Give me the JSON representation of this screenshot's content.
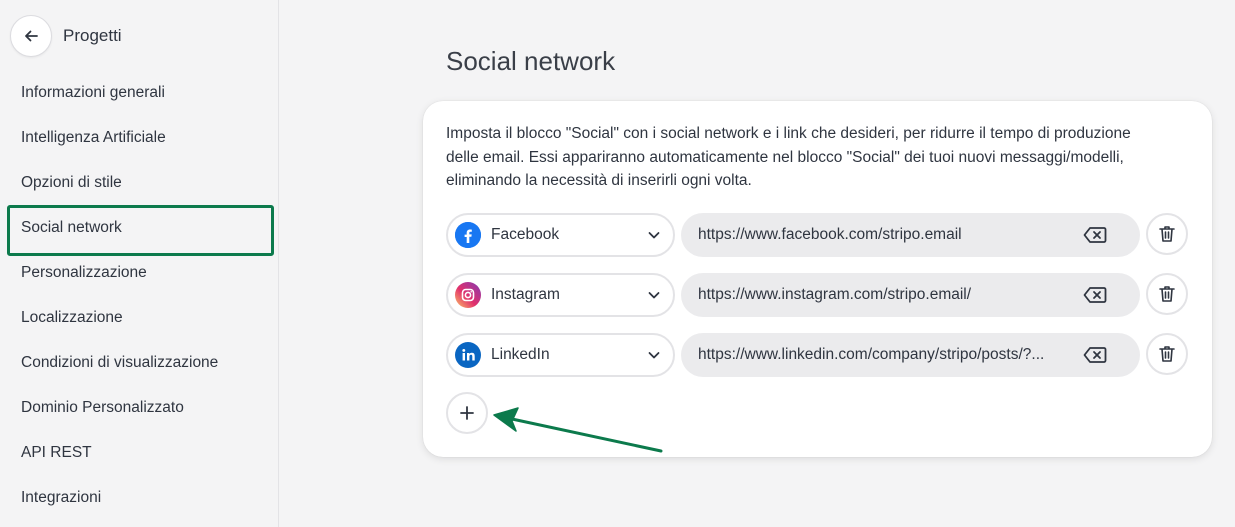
{
  "sidebar": {
    "back_title": "Progetti",
    "items": [
      {
        "label": "Informazioni generali",
        "active": false
      },
      {
        "label": "Intelligenza Artificiale",
        "active": false
      },
      {
        "label": "Opzioni di stile",
        "active": false
      },
      {
        "label": "Social network",
        "active": true
      },
      {
        "label": "Personalizzazione",
        "active": false
      },
      {
        "label": "Localizzazione",
        "active": false
      },
      {
        "label": "Condizioni di visualizzazione",
        "active": false
      },
      {
        "label": "Dominio Personalizzato",
        "active": false
      },
      {
        "label": "API REST",
        "active": false
      },
      {
        "label": "Integrazioni",
        "active": false
      }
    ]
  },
  "main": {
    "title": "Social network",
    "description": "Imposta il blocco \"Social\" con i social network e i link che desideri, per ridurre il tempo di produzione delle email. Essi appariranno automaticamente nel blocco \"Social\" dei tuoi nuovi messaggi/modelli, eliminando la necessità di inserirli ogni volta.",
    "social_rows": [
      {
        "network": "Facebook",
        "icon": "facebook-icon",
        "url": "https://www.facebook.com/stripo.email"
      },
      {
        "network": "Instagram",
        "icon": "instagram-icon",
        "url": "https://www.instagram.com/stripo.email/"
      },
      {
        "network": "LinkedIn",
        "icon": "linkedin-icon",
        "url": "https://www.linkedin.com/company/stripo/posts/?..."
      }
    ],
    "add_button": "+"
  },
  "colors": {
    "active_border": "#0c7a4c",
    "annotation_arrow": "#0c7a4c",
    "facebook": "#1877f2",
    "linkedin": "#0a66c2"
  }
}
